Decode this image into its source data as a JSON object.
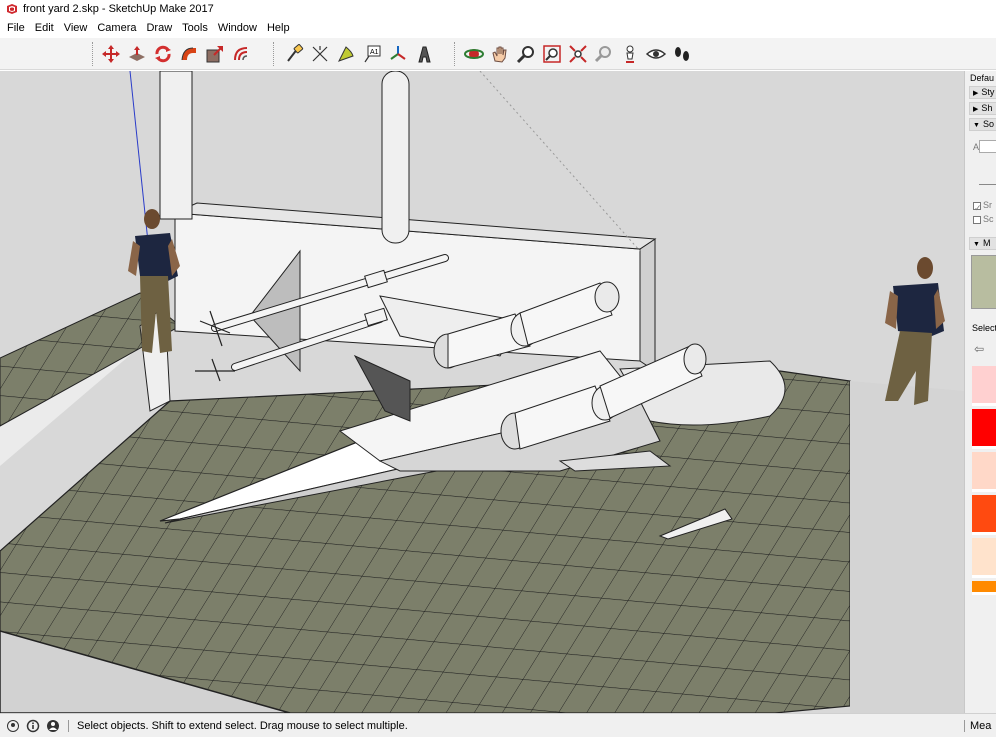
{
  "window": {
    "title": "front yard 2.skp - SketchUp Make 2017",
    "app_icon": "sketchup-logo-icon"
  },
  "menu": {
    "items": [
      "File",
      "Edit",
      "View",
      "Camera",
      "Draw",
      "Tools",
      "Window",
      "Help"
    ]
  },
  "toolbar": {
    "groups": [
      [
        "move-icon",
        "push-pull-icon",
        "rotate-icon",
        "follow-me-icon",
        "scale-icon",
        "offset-icon"
      ],
      [
        "tape-measure-icon",
        "dimension-icon",
        "protractor-icon",
        "text-icon",
        "axes-icon",
        "3d-text-icon"
      ],
      [
        "orbit-icon",
        "pan-icon",
        "zoom-icon",
        "zoom-window-icon",
        "zoom-extents-icon",
        "previous-view-icon",
        "position-camera-icon",
        "look-around-icon",
        "walk-icon"
      ]
    ]
  },
  "tray": {
    "title": "Defau",
    "panels": [
      {
        "label": "Sty",
        "expanded": false
      },
      {
        "label": "Sh",
        "expanded": false
      },
      {
        "label": "So",
        "expanded": true
      }
    ],
    "angle_label": "Angle",
    "checks": [
      {
        "label": "Sr",
        "checked": true
      },
      {
        "label": "Sc",
        "checked": false
      }
    ],
    "materials_panel": {
      "label": "M",
      "expanded": true
    },
    "select_label": "Select",
    "swatches": [
      "#ffd0d0",
      "#ff0000",
      "#ffd8c8",
      "#ff4a10",
      "#ffe3cc",
      "#ff8a00"
    ],
    "current_material": "#b8bda0"
  },
  "status": {
    "text": "Select objects. Shift to extend select. Drag mouse to select multiple.",
    "measurements_label": "Mea"
  }
}
